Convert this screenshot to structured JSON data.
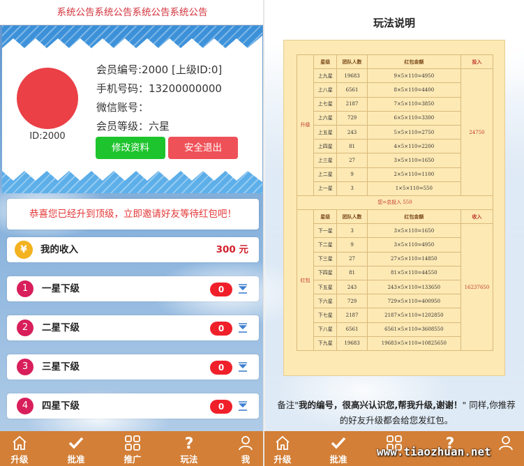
{
  "left": {
    "notice": "系统公告系统公告系统公告系统公告",
    "member_id_label": "ID:2000",
    "info": {
      "member_no": "会员编号:2000 [上级ID:0]",
      "phone": "手机号码：13200000000",
      "wechat": "微信账号：",
      "level": "会员等级：六星"
    },
    "buttons": {
      "edit": "修改资料",
      "logout": "安全退出"
    },
    "congrats": "恭喜您已经升到顶级，立即邀请好友等待红包吧！",
    "income": {
      "icon": "¥",
      "label": "我的收入",
      "value": "300 元"
    },
    "levels": [
      {
        "num": "1",
        "label": "一星下级",
        "count": "0"
      },
      {
        "num": "2",
        "label": "二星下级",
        "count": "0"
      },
      {
        "num": "3",
        "label": "三星下级",
        "count": "0"
      },
      {
        "num": "4",
        "label": "四星下级",
        "count": "0"
      }
    ],
    "nav": [
      {
        "icon": "home-icon",
        "label": "升级"
      },
      {
        "icon": "check-icon",
        "label": "批准"
      },
      {
        "icon": "grid-icon",
        "label": "推广"
      },
      {
        "icon": "question-icon",
        "label": "玩法"
      },
      {
        "icon": "user-icon",
        "label": "我"
      }
    ]
  },
  "right": {
    "title": "玩法说明",
    "table": {
      "upgrade_headers": [
        "星级",
        "团队人数",
        "红包金额",
        "投入"
      ],
      "upgrade_group": "升级",
      "upgrade_total": "24750",
      "upgrade_rows": [
        [
          "上九星",
          "19683",
          "9×5×110=4950"
        ],
        [
          "上八星",
          "6561",
          "8×5×110=4400"
        ],
        [
          "上七星",
          "2187",
          "7×5×110=3850"
        ],
        [
          "上六星",
          "729",
          "6×5×110=3300"
        ],
        [
          "上五星",
          "243",
          "5×5×110=2750"
        ],
        [
          "上四星",
          "81",
          "4×5×110=2200"
        ],
        [
          "上三星",
          "27",
          "3×5×110=1650"
        ],
        [
          "上二星",
          "9",
          "2×5×110=1100"
        ],
        [
          "上一星",
          "3",
          "1×5×110=550"
        ]
      ],
      "middle": "您=总投入 550",
      "redpack_headers": [
        "星级",
        "团队人数",
        "红包金额",
        "收入"
      ],
      "redpack_group": "红包",
      "redpack_total": "16237650",
      "redpack_rows": [
        [
          "下一星",
          "3",
          "3×5×110=1650"
        ],
        [
          "下二星",
          "9",
          "3×5×110=4950"
        ],
        [
          "下三星",
          "27",
          "27×5×110=14850"
        ],
        [
          "下四星",
          "81",
          "81×5×110=44550"
        ],
        [
          "下五星",
          "243",
          "243×5×110=133650"
        ],
        [
          "下六星",
          "729",
          "729×5×110=400950"
        ],
        [
          "下七星",
          "2187",
          "2187×5×110=1202850"
        ],
        [
          "下八星",
          "6561",
          "6561×5×110=3608550"
        ],
        [
          "下九星",
          "19683",
          "19683×5×110=10825650"
        ]
      ]
    },
    "note_prefix": "备注\"",
    "note_bold": "我的编号，很高兴认识您,帮我升级,谢谢！",
    "note_suffix": "\" 同样,你推荐的好友升级都会给您发红包。",
    "nav": [
      {
        "icon": "home-icon",
        "label": "升级"
      },
      {
        "icon": "check-icon",
        "label": "批准"
      },
      {
        "icon": "grid-icon",
        "label": ""
      },
      {
        "icon": "question-icon",
        "label": ""
      },
      {
        "icon": "user-icon",
        "label": ""
      }
    ],
    "watermark": "www.tiaozhuan.net"
  },
  "colors": {
    "nav_bg": "#d37f37",
    "accent_red": "#ef5158",
    "accent_green": "#1ec42d",
    "badge_red": "#f0202a",
    "level_pink": "#d81e5b"
  }
}
